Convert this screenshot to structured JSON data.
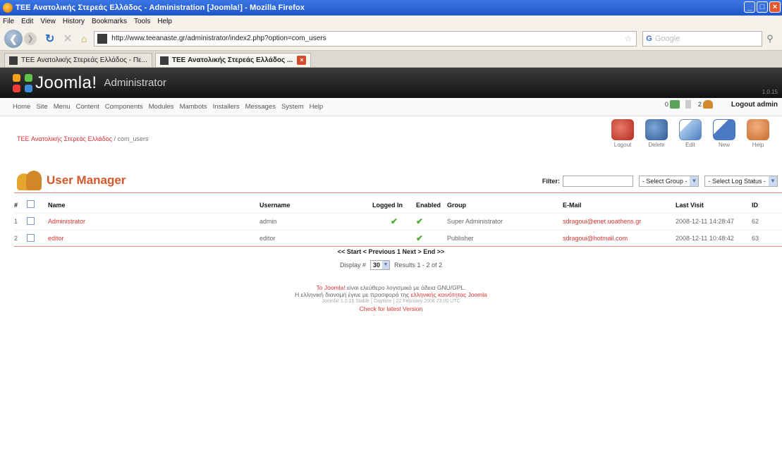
{
  "browser": {
    "title": "TEE Ανατολικής Στερεάς Ελλάδος - Administration [Joomla!] - Mozilla Firefox",
    "menu": [
      "File",
      "Edit",
      "View",
      "History",
      "Bookmarks",
      "Tools",
      "Help"
    ],
    "url": "http://www.teeanaste.gr/administrator/index2.php?option=com_users",
    "search_engine": "G",
    "search_placeholder": "Google",
    "tabs": [
      {
        "label": "TEE Ανατολικής Στερεάς Ελλάδος - Πε...",
        "active": false
      },
      {
        "label": "TEE Ανατολικής Στερεάς Ελλάδος ...",
        "active": true
      }
    ]
  },
  "joomla": {
    "logo_text": "Joomla!",
    "logo_sub": "Administrator",
    "version": "1.0.15",
    "menu": [
      "Home",
      "Site",
      "Menu",
      "Content",
      "Components",
      "Modules",
      "Mambots",
      "Installers",
      "Messages",
      "System",
      "Help"
    ],
    "status": {
      "messages": "0",
      "users": "2",
      "logout": "Logout admin"
    },
    "breadcrumb": {
      "site": "TEE Ανατολικής Στερεάς Ελλάδος",
      "path": "/ com_users"
    },
    "toolbar": [
      "Logout",
      "Delete",
      "Edit",
      "New",
      "Help"
    ],
    "page_title": "User Manager",
    "filter": {
      "label": "Filter:",
      "value": "",
      "group": "- Select Group -",
      "log": "- Select Log Status -"
    },
    "table": {
      "headers": [
        "#",
        "",
        "Name",
        "Username",
        "Logged In",
        "Enabled",
        "Group",
        "E-Mail",
        "Last Visit",
        "ID"
      ],
      "rows": [
        {
          "num": "1",
          "name": "Administrator",
          "username": "admin",
          "logged_in": "✔",
          "enabled": "✔",
          "group": "Super Administrator",
          "email": "sdragoui@enet.uoathens.gr",
          "last_visit": "2008-12-11 14:28:47",
          "id": "62"
        },
        {
          "num": "2",
          "name": "editor",
          "username": "editor",
          "logged_in": "",
          "enabled": "✔",
          "group": "Publisher",
          "email": "sdragoui@hotmail.com",
          "last_visit": "2008-12-11 10:48:42",
          "id": "63"
        }
      ]
    },
    "pager": "<< Start < Previous 1 Next > End >>",
    "display_label": "Display #",
    "display_value": "30",
    "results": "Results 1 - 2 of 2",
    "footer": {
      "line1_red": "To Joomla!",
      "line1": " είναι ελεύθερο λογισμικό με άδεια GNU/GPL.",
      "line2": "Η ελληνική διανομή έγινε με προσφορά της ",
      "line2_red": "ελληνικής κοινότητας Joomla",
      "line3": "Joomla! 1.0.15 Stable [ Daytime ] 22 February 2008 23:00 UTC",
      "line4": "Check for latest Version"
    },
    "colors": {
      "accent": "#d4582a",
      "link": "#dd3333",
      "check": "#4caa2e"
    }
  }
}
